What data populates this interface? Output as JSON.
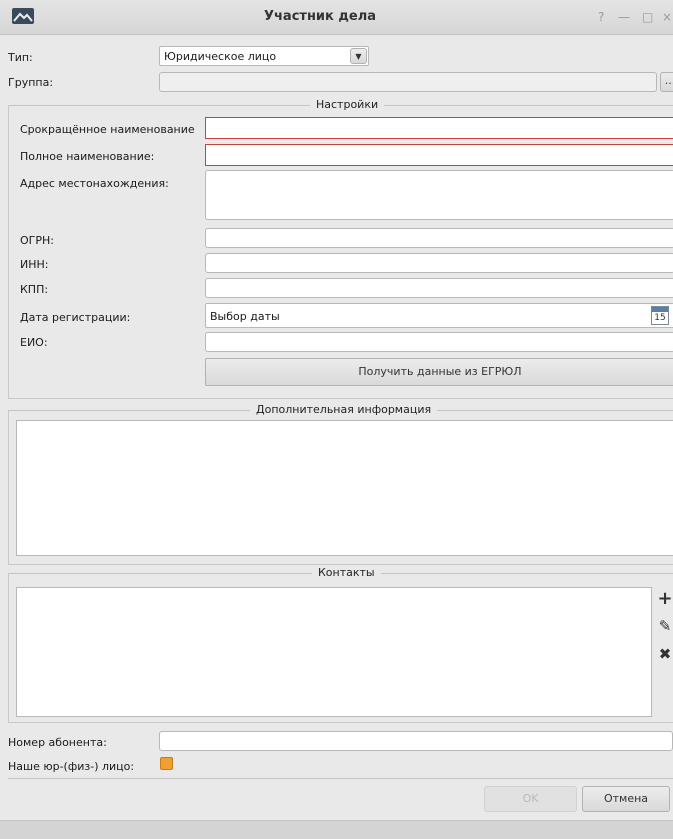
{
  "window": {
    "title": "Участник дела",
    "help": "?",
    "minimize": "—",
    "maximize": "□",
    "close": "×"
  },
  "type_row": {
    "label": "Тип:",
    "value": "Юридическое лицо",
    "arrow": "▼"
  },
  "group_row": {
    "label": "Группа:",
    "browse": "..."
  },
  "settings": {
    "title": "Настройки",
    "short_name_label": "Срокращённое наименование",
    "full_name_label": "Полное наименование:",
    "address_label": "Адрес местонахождения:",
    "ogrn_label": "ОГРН:",
    "inn_label": "ИНН:",
    "kpp_label": "КПП:",
    "reg_date_label": "Дата регистрации:",
    "reg_date_placeholder": "Выбор даты",
    "calendar_day": "15",
    "eio_label": "ЕИО:",
    "egrul_button": "Получить данные из ЕГРЮЛ"
  },
  "additional": {
    "title": "Дополнительная информация"
  },
  "contacts": {
    "title": "Контакты",
    "add": "+",
    "edit": "✎",
    "delete": "✖"
  },
  "subscriber": {
    "label": "Номер абонента:"
  },
  "own_entity": {
    "label": "Наше юр-(физ-) лицо:"
  },
  "footer": {
    "ok": "OK",
    "cancel": "Отмена"
  },
  "colors": {
    "error_border": "#c94040",
    "checkbox": "#f0a030"
  }
}
